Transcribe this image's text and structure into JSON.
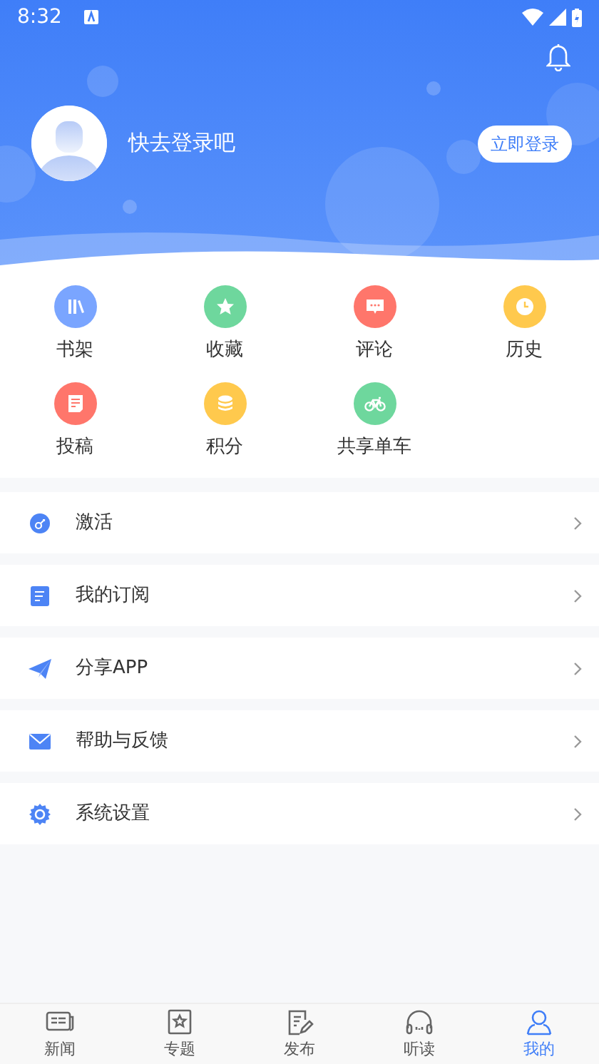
{
  "status_bar": {
    "time": "8:32"
  },
  "profile": {
    "name": "快去登录吧",
    "login_button": "立即登录"
  },
  "shortcuts": [
    {
      "label": "书架",
      "kind": "books",
      "color": "#7aa5ff"
    },
    {
      "label": "收藏",
      "kind": "star",
      "color": "#6ed79d"
    },
    {
      "label": "评论",
      "kind": "comment",
      "color": "#ff766b"
    },
    {
      "label": "历史",
      "kind": "clock",
      "color": "#ffc94d"
    },
    {
      "label": "投稿",
      "kind": "document",
      "color": "#ff766b"
    },
    {
      "label": "积分",
      "kind": "coins",
      "color": "#ffc94d"
    },
    {
      "label": "共享单车",
      "kind": "bike",
      "color": "#6ed79d"
    }
  ],
  "menu": [
    {
      "label": "激活",
      "kind": "key"
    },
    {
      "label": "我的订阅",
      "kind": "list"
    },
    {
      "label": "分享APP",
      "kind": "plane"
    },
    {
      "label": "帮助与反馈",
      "kind": "mail"
    },
    {
      "label": "系统设置",
      "kind": "gear"
    }
  ],
  "tabs": [
    {
      "label": "新闻",
      "kind": "news",
      "selected": false
    },
    {
      "label": "专题",
      "kind": "topic",
      "selected": false
    },
    {
      "label": "发布",
      "kind": "edit",
      "selected": false
    },
    {
      "label": "听读",
      "kind": "headphones",
      "selected": false
    },
    {
      "label": "我的",
      "kind": "person",
      "selected": true
    }
  ]
}
